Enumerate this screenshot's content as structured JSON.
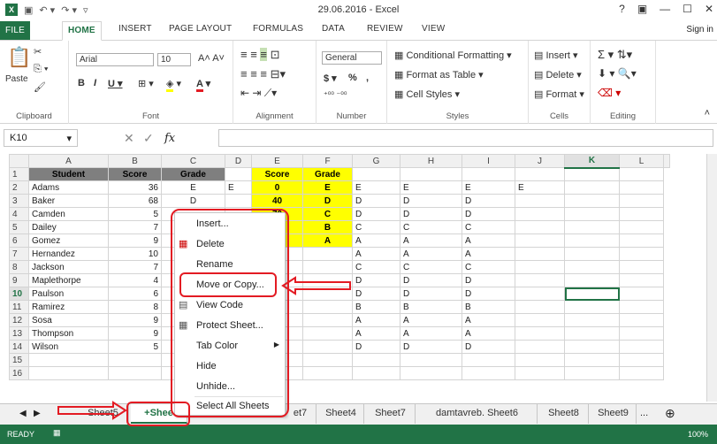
{
  "app": {
    "title": "29.06.2016 - Excel",
    "qat": [
      "save-icon",
      "undo-icon",
      "redo-icon",
      "customize-icon"
    ],
    "window_controls": [
      "?",
      "▣",
      "—",
      "☐",
      "✕"
    ]
  },
  "tabs": [
    "FILE",
    "HOME",
    "INSERT",
    "PAGE LAYOUT",
    "FORMULAS",
    "DATA",
    "REVIEW",
    "VIEW"
  ],
  "signin": "Sign in",
  "ribbon": {
    "clipboard": {
      "label": "Clipboard",
      "paste": "Paste"
    },
    "font": {
      "label": "Font",
      "name": "Arial",
      "size": "10"
    },
    "alignment": {
      "label": "Alignment"
    },
    "number": {
      "label": "Number",
      "format": "General",
      "currency": "$",
      "percent": "%",
      "comma": ","
    },
    "styles": {
      "label": "Styles",
      "cond": "Conditional Formatting",
      "table": "Format as Table",
      "cell": "Cell Styles"
    },
    "cells": {
      "label": "Cells",
      "insert": "Insert",
      "delete": "Delete",
      "format": "Format"
    },
    "editing": {
      "label": "Editing"
    }
  },
  "namebox": "K10",
  "fx": "fx",
  "columns": [
    "A",
    "B",
    "C",
    "D",
    "E",
    "F",
    "G",
    "H",
    "I",
    "J",
    "K",
    "L"
  ],
  "rows": [
    [
      "1",
      "Student",
      "Score",
      "Grade",
      "",
      "Score",
      "Grade",
      "",
      "",
      "",
      "",
      "",
      ""
    ],
    [
      "2",
      "Adams",
      "36",
      "E",
      "E",
      "0",
      "E",
      "E",
      "E",
      "E",
      "E",
      "",
      ""
    ],
    [
      "3",
      "Baker",
      "68",
      "D",
      "",
      "40",
      "D",
      "D",
      "D",
      "D",
      "",
      "",
      ""
    ],
    [
      "4",
      "Camden",
      "5",
      "",
      "",
      "70",
      "C",
      "D",
      "D",
      "D",
      "",
      "",
      ""
    ],
    [
      "5",
      "Dailey",
      "7",
      "",
      "",
      "80",
      "B",
      "C",
      "C",
      "C",
      "",
      "",
      ""
    ],
    [
      "6",
      "Gomez",
      "9",
      "",
      "",
      "90",
      "A",
      "A",
      "A",
      "A",
      "",
      "",
      ""
    ],
    [
      "7",
      "Hernandez",
      "10",
      "",
      "",
      "",
      "",
      "A",
      "A",
      "A",
      "",
      "",
      ""
    ],
    [
      "8",
      "Jackson",
      "7",
      "",
      "",
      "",
      "",
      "C",
      "C",
      "C",
      "",
      "",
      ""
    ],
    [
      "9",
      "Maplethorpe",
      "4",
      "",
      "",
      "",
      "",
      "D",
      "D",
      "D",
      "",
      "",
      ""
    ],
    [
      "10",
      "Paulson",
      "6",
      "",
      "",
      "",
      "",
      "D",
      "D",
      "D",
      "",
      "",
      ""
    ],
    [
      "11",
      "Ramirez",
      "8",
      "",
      "",
      "",
      "",
      "B",
      "B",
      "B",
      "",
      "",
      ""
    ],
    [
      "12",
      "Sosa",
      "9",
      "",
      "",
      "",
      "",
      "A",
      "A",
      "A",
      "",
      "",
      ""
    ],
    [
      "13",
      "Thompson",
      "9",
      "",
      "",
      "",
      "",
      "A",
      "A",
      "A",
      "",
      "",
      ""
    ],
    [
      "14",
      "Wilson",
      "5",
      "",
      "",
      "",
      "",
      "D",
      "D",
      "D",
      "",
      "",
      ""
    ],
    [
      "15",
      "",
      "",
      "",
      "",
      "",
      "",
      "",
      "",
      "",
      "",
      "",
      ""
    ],
    [
      "16",
      "",
      "",
      "",
      "",
      "",
      "",
      "",
      "",
      "",
      "",
      "",
      ""
    ]
  ],
  "sheets": [
    "...",
    "Sheet5",
    "+Shee",
    "et7",
    "Sheet4",
    "Sheet7",
    "damtavreb. Sheet6",
    "Sheet8",
    "Sheet9"
  ],
  "sheet_more": "...",
  "status": {
    "ready": "READY",
    "zoom": "100%"
  },
  "context_menu": [
    "Insert...",
    "Delete",
    "Rename",
    "Move or Copy...",
    "View Code",
    "Protect Sheet...",
    "Tab Color",
    "Hide",
    "Unhide...",
    "Select All Sheets"
  ],
  "annotation_color": "#e31b23",
  "accent": "#217346"
}
